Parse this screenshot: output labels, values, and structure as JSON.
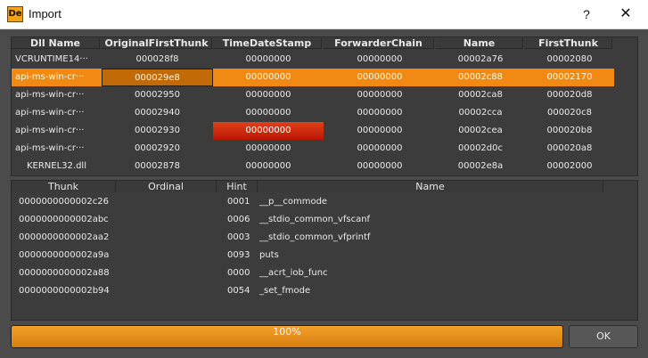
{
  "window": {
    "title": "Import",
    "icon_text": "De",
    "help_label": "?",
    "close_label": "✕"
  },
  "dll_table": {
    "headers": [
      "Dll Name",
      "OriginalFirstThunk",
      "TimeDateStamp",
      "ForwarderChain",
      "Name",
      "FirstThunk"
    ],
    "rows": [
      [
        "VCRUNTIME14···",
        "000028f8",
        "00000000",
        "00000000",
        "00002a76",
        "00002080"
      ],
      [
        "api-ms-win-cr···",
        "000029e8",
        "00000000",
        "00000000",
        "00002c88",
        "00002170"
      ],
      [
        "api-ms-win-cr···",
        "00002950",
        "00000000",
        "00000000",
        "00002ca8",
        "000020d8"
      ],
      [
        "api-ms-win-cr···",
        "00002940",
        "00000000",
        "00000000",
        "00002cca",
        "000020c8"
      ],
      [
        "api-ms-win-cr···",
        "00002930",
        "00000000",
        "00000000",
        "00002cea",
        "000020b8"
      ],
      [
        "api-ms-win-cr···",
        "00002920",
        "00000000",
        "00000000",
        "00002d0c",
        "000020a8"
      ],
      [
        "KERNEL32.dll",
        "00002878",
        "00000000",
        "00000000",
        "00002e8a",
        "00002000"
      ]
    ],
    "selected_row": 1
  },
  "thunk_table": {
    "headers": [
      "Thunk",
      "Ordinal",
      "Hint",
      "Name"
    ],
    "rows": [
      [
        "0000000000002c26",
        "",
        "0001",
        "__p__commode"
      ],
      [
        "0000000000002abc",
        "",
        "0006",
        "__stdio_common_vfscanf"
      ],
      [
        "0000000000002aa2",
        "",
        "0003",
        "__stdio_common_vfprintf"
      ],
      [
        "0000000000002a9a",
        "",
        "0093",
        "puts"
      ],
      [
        "0000000000002a88",
        "",
        "0000",
        "__acrt_iob_func"
      ],
      [
        "0000000000002b94",
        "",
        "0054",
        "_set_fmode"
      ]
    ]
  },
  "progress": {
    "value": 1.0,
    "label": "100%"
  },
  "ok_label": "OK",
  "colors": {
    "accent": "#f08a14",
    "highlight_red": "#c9230c",
    "background": "#4b4b4b"
  }
}
